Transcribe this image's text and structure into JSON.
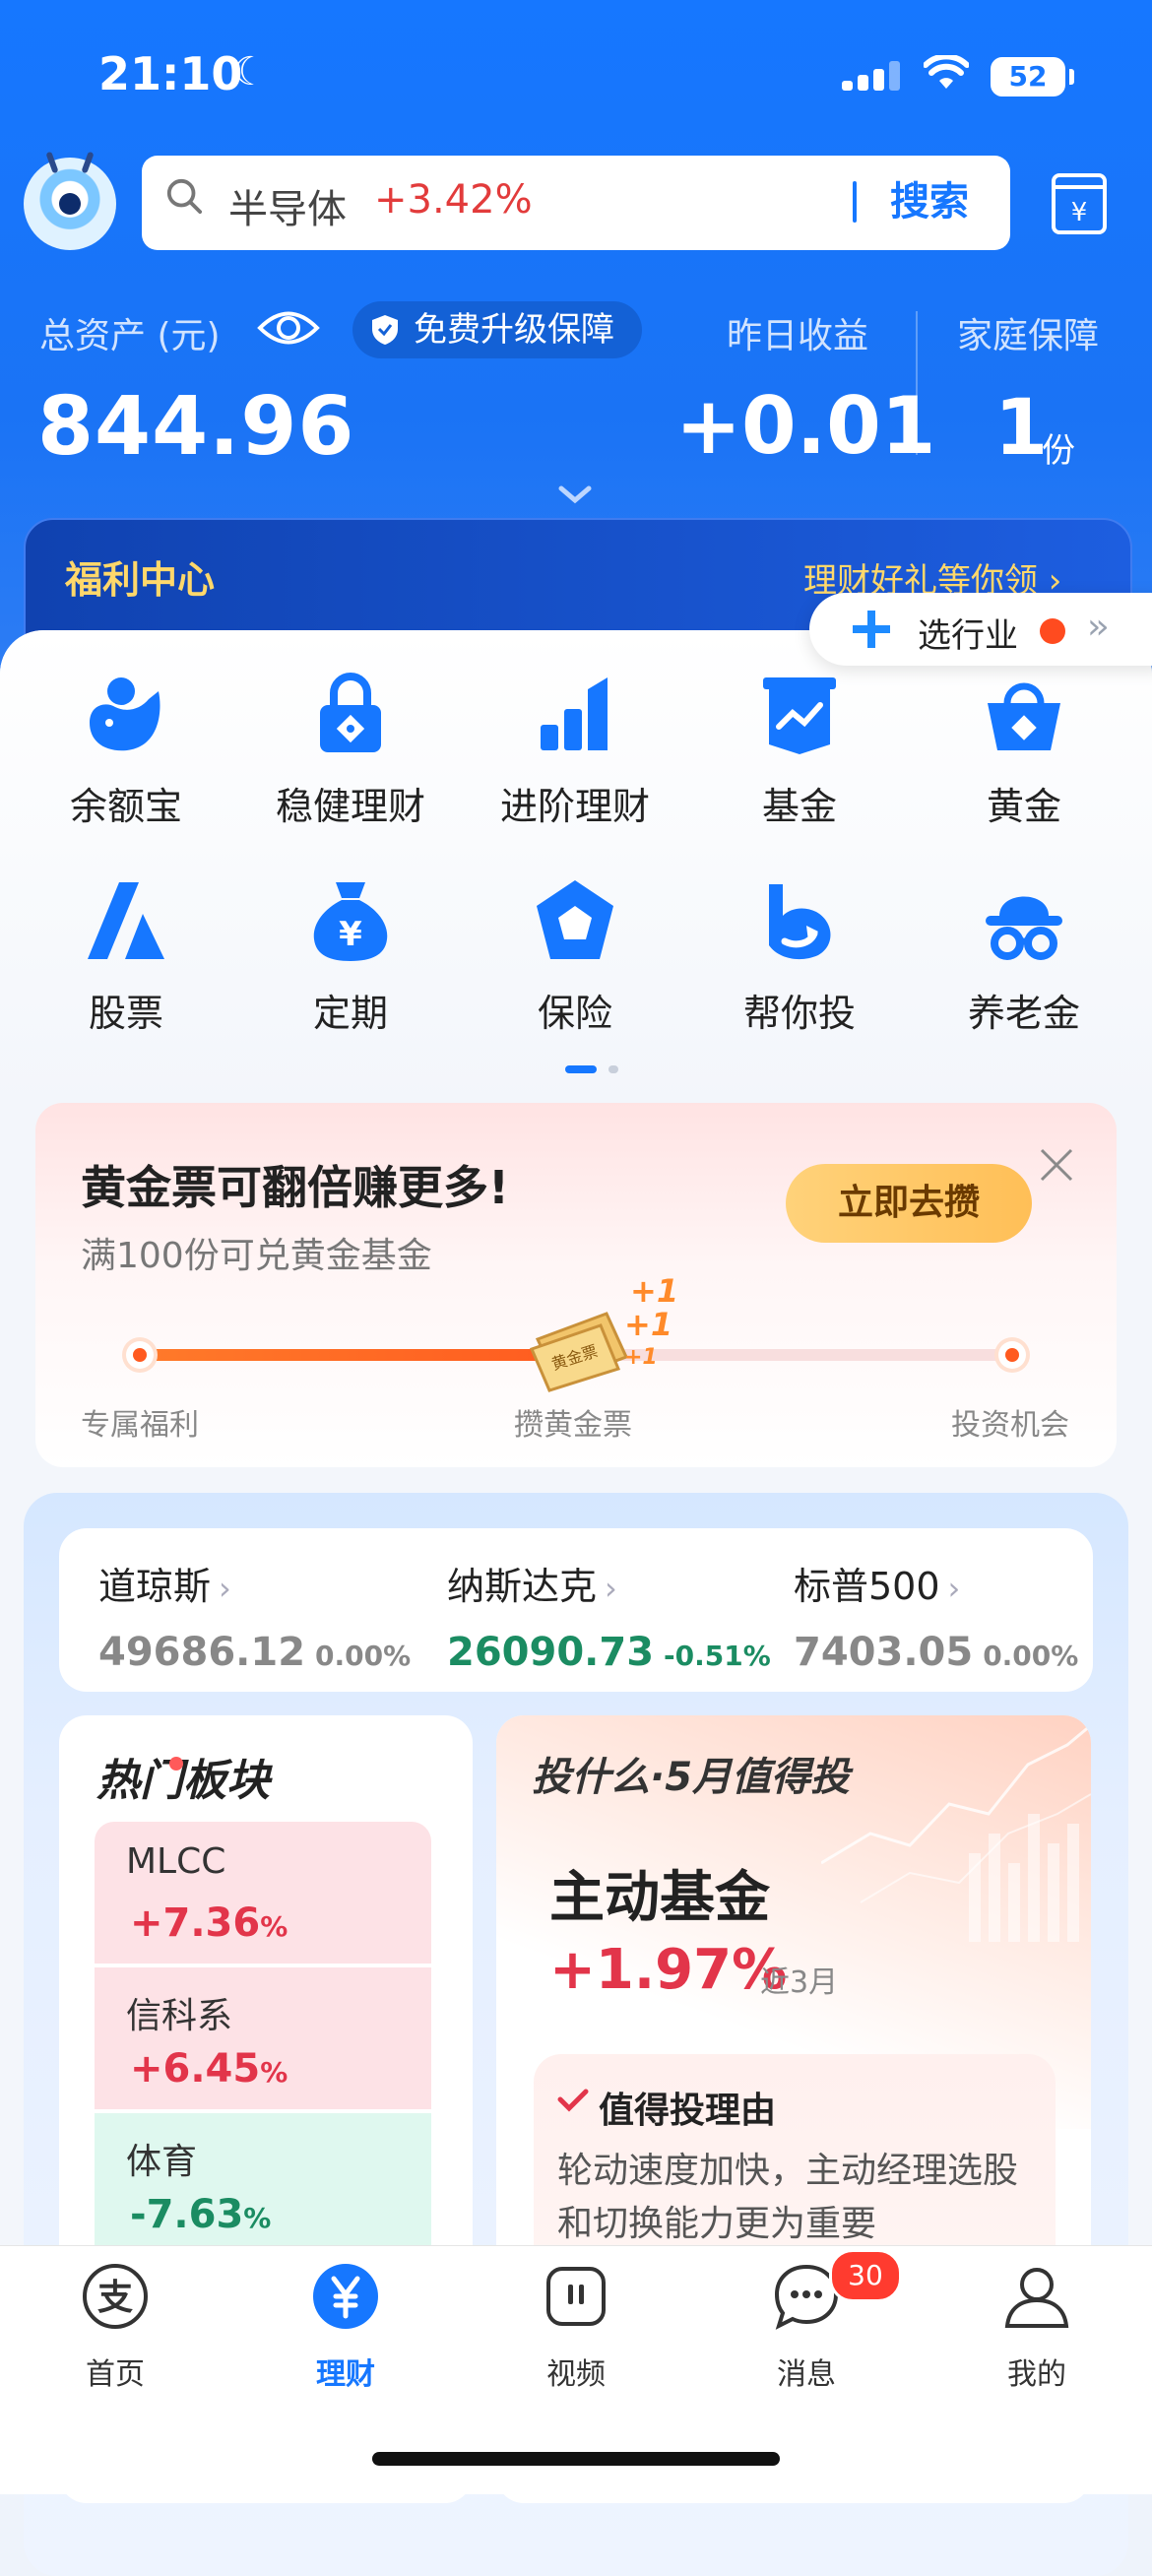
{
  "status": {
    "time": "21:10",
    "battery": "52"
  },
  "search": {
    "keyword": "半导体",
    "change": "+3.42%",
    "button": "搜索"
  },
  "assets": {
    "label": "总资产 (元)",
    "value": "844.96",
    "protect_label": "免费升级保障",
    "yesterday_label": "昨日收益",
    "yesterday_value": "+0.01",
    "family_label": "家庭保障",
    "family_value": "1",
    "family_unit": "份"
  },
  "welfare": {
    "title": "福利中心",
    "link": "理财好礼等你领 ›"
  },
  "industry": {
    "label": "选行业",
    "arrows": "››"
  },
  "grid": [
    {
      "label": "余额宝",
      "icon": "yuebao-icon"
    },
    {
      "label": "稳健理财",
      "icon": "lock-icon"
    },
    {
      "label": "进阶理财",
      "icon": "bar-chart-icon"
    },
    {
      "label": "基金",
      "icon": "fund-chart-icon"
    },
    {
      "label": "黄金",
      "icon": "gold-basket-icon"
    },
    {
      "label": "股票",
      "icon": "stock-icon"
    },
    {
      "label": "定期",
      "icon": "money-bag-icon"
    },
    {
      "label": "保险",
      "icon": "insurance-icon"
    },
    {
      "label": "帮你投",
      "icon": "help-invest-icon"
    },
    {
      "label": "养老金",
      "icon": "pension-icon"
    }
  ],
  "gold_card": {
    "title": "黄金票可翻倍赚更多!",
    "subtitle": "满100份可兑黄金基金",
    "button": "立即去攒",
    "ticket_label": "黄金票",
    "plus": [
      "+1",
      "+1",
      "+1"
    ],
    "steps": [
      "专属福利",
      "攒黄金票",
      "投资机会"
    ],
    "progress": 0.52
  },
  "indices": [
    {
      "name": "道琼斯",
      "value": "49686.12",
      "change": "0.00%",
      "trend": "flat"
    },
    {
      "name": "纳斯达克",
      "value": "26090.73",
      "change": "-0.51%",
      "trend": "down"
    },
    {
      "name": "标普500",
      "value": "7403.05",
      "change": "0.00%",
      "trend": "flat"
    }
  ],
  "hot": {
    "title": "热门板块",
    "sectors": [
      {
        "name": "MLCC",
        "change": "+7.36",
        "unit": "%",
        "dir": "up"
      },
      {
        "name": "信科系",
        "change": "+6.45",
        "unit": "%",
        "dir": "up"
      },
      {
        "name": "体育",
        "change": "-7.63",
        "unit": "%",
        "dir": "dn"
      }
    ]
  },
  "invest": {
    "title": "投什么·5月值得投",
    "fund": "主动基金",
    "rate": "+1.97%",
    "period": "近3月",
    "reason_title": "值得投理由",
    "reason_body": "轮动速度加快，主动经理选股和切换能力更为重要"
  },
  "tabs": [
    {
      "label": "首页",
      "icon": "alipay-icon"
    },
    {
      "label": "理财",
      "icon": "finance-yuan-icon"
    },
    {
      "label": "视频",
      "icon": "video-icon"
    },
    {
      "label": "消息",
      "icon": "message-icon"
    },
    {
      "label": "我的",
      "icon": "profile-icon"
    }
  ],
  "message_badge": "30",
  "colors": {
    "brand": "#1677ff",
    "up": "#e2354a",
    "down": "#1b8c62",
    "gold": "#ffbf57"
  }
}
